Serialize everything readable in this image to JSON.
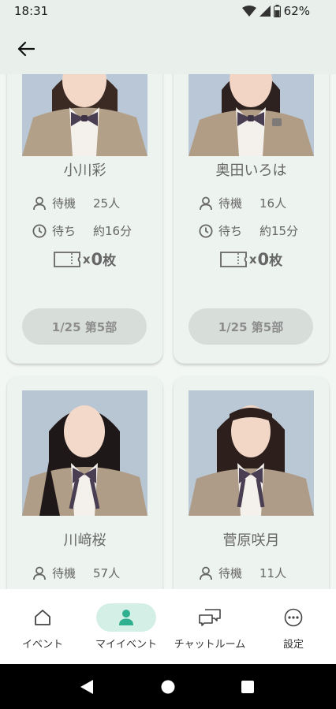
{
  "status_bar": {
    "time": "18:31",
    "battery": "62%"
  },
  "app_bar": {
    "back_icon": "arrow-left-icon"
  },
  "cards": [
    {
      "name": "小川彩",
      "waiting_label": "待機",
      "waiting_value": "25人",
      "wait_time_label": "待ち",
      "wait_time_value": "約16分",
      "ticket_x": "x",
      "ticket_count": "0",
      "ticket_unit": "枚",
      "session": "1/25 第5部"
    },
    {
      "name": "奥田いろは",
      "waiting_label": "待機",
      "waiting_value": "16人",
      "wait_time_label": "待ち",
      "wait_time_value": "約15分",
      "ticket_x": "x",
      "ticket_count": "0",
      "ticket_unit": "枚",
      "session": "1/25 第5部"
    },
    {
      "name": "川﨑桜",
      "waiting_label": "待機",
      "waiting_value": "57人"
    },
    {
      "name": "菅原咲月",
      "waiting_label": "待機",
      "waiting_value": "11人"
    }
  ],
  "bottom_nav": [
    {
      "label": "イベント",
      "icon": "home-icon"
    },
    {
      "label": "マイイベント",
      "icon": "person-icon",
      "active": true
    },
    {
      "label": "チャットルーム",
      "icon": "chat-icon"
    },
    {
      "label": "設定",
      "icon": "more-icon"
    }
  ],
  "colors": {
    "accent": "#2fb08f",
    "active_pill": "#d3efe6",
    "card_bg": "#edf3ef",
    "button_disabled": "#d7ddd9"
  }
}
